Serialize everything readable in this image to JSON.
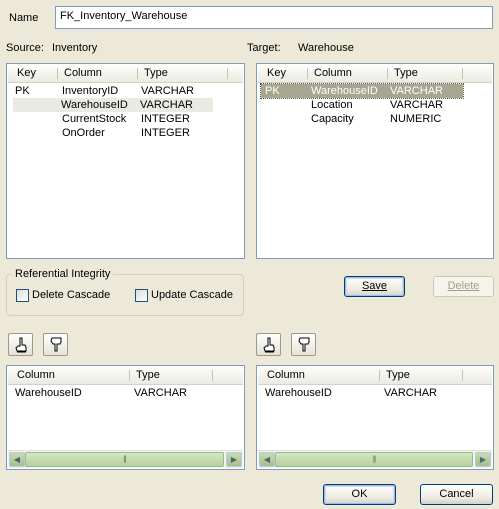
{
  "name": {
    "label": "Name",
    "value": "FK_Inventory_Warehouse"
  },
  "source": {
    "label": "Source:",
    "table": "Inventory",
    "columns_header": [
      "Key",
      "Column",
      "Type"
    ],
    "rows": [
      {
        "key": "PK",
        "column": "InventoryID",
        "type": "VARCHAR"
      },
      {
        "key": "",
        "column": "WarehouseID",
        "type": "VARCHAR"
      },
      {
        "key": "",
        "column": "CurrentStock",
        "type": "INTEGER"
      },
      {
        "key": "",
        "column": "OnOrder",
        "type": "INTEGER"
      }
    ]
  },
  "target": {
    "label": "Target:",
    "table": "Warehouse",
    "columns_header": [
      "Key",
      "Column",
      "Type"
    ],
    "rows": [
      {
        "key": "PK",
        "column": "WarehouseID",
        "type": "VARCHAR"
      },
      {
        "key": "",
        "column": "Location",
        "type": "VARCHAR"
      },
      {
        "key": "",
        "column": "Capacity",
        "type": "NUMERIC"
      }
    ]
  },
  "referential_integrity": {
    "title": "Referential Integrity",
    "delete_cascade": "Delete Cascade",
    "update_cascade": "Update Cascade"
  },
  "buttons": {
    "save": "Save",
    "delete": "Delete",
    "ok": "OK",
    "cancel": "Cancel"
  },
  "source_fk": {
    "columns_header": [
      "Column",
      "Type"
    ],
    "rows": [
      {
        "column": "WarehouseID",
        "type": "VARCHAR"
      }
    ]
  },
  "target_fk": {
    "columns_header": [
      "Column",
      "Type"
    ],
    "rows": [
      {
        "column": "WarehouseID",
        "type": "VARCHAR"
      }
    ]
  },
  "icons": {
    "move_up": "hand-up-icon",
    "move_down": "hand-down-icon"
  },
  "colors": {
    "selection": "#a7a690",
    "row_highlight": "#ebeae2"
  }
}
